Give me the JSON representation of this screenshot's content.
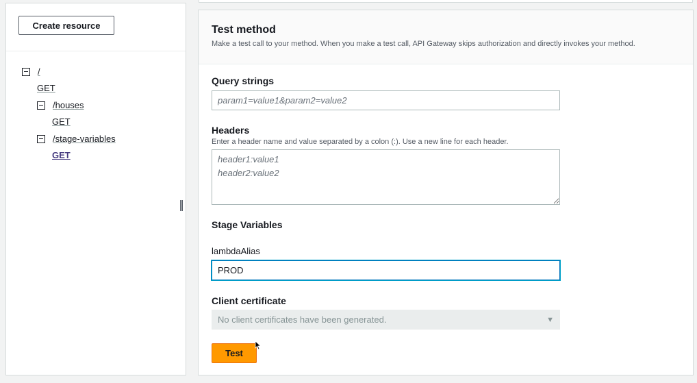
{
  "sidebar": {
    "create_resource_label": "Create resource",
    "tree": [
      {
        "path": "/",
        "method": "GET"
      },
      {
        "path": "/houses",
        "method": "GET"
      },
      {
        "path": "/stage-variables",
        "method": "GET"
      }
    ]
  },
  "test_method": {
    "title": "Test method",
    "description": "Make a test call to your method. When you make a test call, API Gateway skips authorization and directly invokes your method.",
    "query_strings": {
      "label": "Query strings",
      "placeholder": "param1=value1&param2=value2",
      "value": ""
    },
    "headers": {
      "label": "Headers",
      "hint": "Enter a header name and value separated by a colon (:). Use a new line for each header.",
      "placeholder": "header1:value1\nheader2:value2",
      "value": ""
    },
    "stage_variables": {
      "label": "Stage Variables",
      "variable_name": "lambdaAlias",
      "variable_value": "PROD"
    },
    "client_certificate": {
      "label": "Client certificate",
      "selected": "No client certificates have been generated."
    },
    "test_label": "Test"
  },
  "colors": {
    "accent_orange": "#ff9900",
    "link_selected": "#44397f",
    "focus_blue": "#0073bb"
  },
  "icons": {
    "tree_toggle": "collapse-square-icon",
    "select_chevron": "caret-down-icon",
    "splitter": "drag-handle-icon",
    "pointer": "mouse-cursor-icon"
  }
}
